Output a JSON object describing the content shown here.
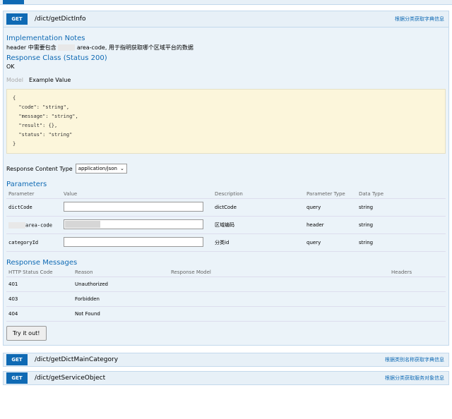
{
  "op1": {
    "method": "GET",
    "path": "/dict/getDictInfo",
    "summary": "根据分类获取字典信息",
    "impl_title": "Implementation Notes",
    "impl_text_pre": "header 中需要包含",
    "impl_text_post": "area-code, 用于指明获取哪个区域平台的数据",
    "response_class_title": "Response Class (Status 200)",
    "response_class_value": "OK",
    "tab_model": "Model",
    "tab_example": "Example Value",
    "json_lines": [
      "{",
      "  \"code\": \"string\",",
      "  \"message\": \"string\",",
      "  \"result\": {},",
      "  \"status\": \"string\"",
      "}"
    ],
    "rct_label": "Response Content Type",
    "rct_value": "application/json",
    "params_title": "Parameters",
    "param_headers": [
      "Parameter",
      "Value",
      "Description",
      "Parameter Type",
      "Data Type"
    ],
    "params": [
      {
        "name": "dictCode",
        "desc": "dictCode",
        "ptype": "query",
        "dtype": "string"
      },
      {
        "name": "area-code",
        "desc": "区域编码",
        "ptype": "header",
        "dtype": "string"
      },
      {
        "name": "categoryId",
        "desc": "分类id",
        "ptype": "query",
        "dtype": "string"
      }
    ],
    "resp_title": "Response Messages",
    "resp_headers": [
      "HTTP Status Code",
      "Reason",
      "Response Model",
      "Headers"
    ],
    "responses": [
      {
        "code": "401",
        "reason": "Unauthorized"
      },
      {
        "code": "403",
        "reason": "Forbidden"
      },
      {
        "code": "404",
        "reason": "Not Found"
      }
    ],
    "try_label": "Try it out!"
  },
  "ops": [
    {
      "method": "GET",
      "path": "/dict/getDictMainCategory",
      "summary": "根据类别名称获取字典信息"
    },
    {
      "method": "GET",
      "path": "/dict/getServiceObject",
      "summary": "根据分类获取服务对象信息"
    }
  ]
}
